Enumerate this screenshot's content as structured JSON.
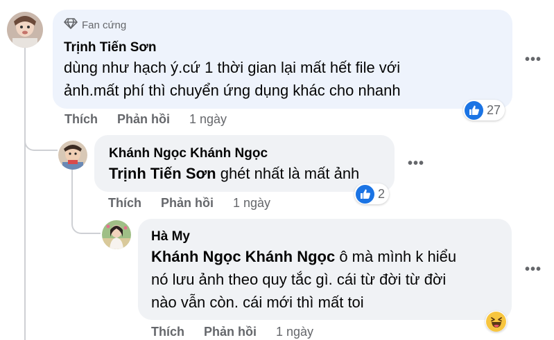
{
  "comments": [
    {
      "badge": "Fan cứng",
      "author": "Trịnh Tiến Sơn",
      "text_line1": "dùng như hạch ý.cứ 1 thời gian lại mất hết file với",
      "text_line2": "ảnh.mất phí thì chuyển ứng dụng khác cho nhanh",
      "reaction_count": "27",
      "like_label": "Thích",
      "reply_label": "Phản hồi",
      "time": "1 ngày"
    },
    {
      "author": "Khánh Ngọc Khánh Ngọc",
      "mention": "Trịnh Tiến Sơn",
      "text": " ghét nhất là mất ảnh",
      "reaction_count": "2",
      "like_label": "Thích",
      "reply_label": "Phản hồi",
      "time": "1 ngày"
    },
    {
      "author": "Hà My",
      "mention": "Khánh Ngọc Khánh Ngọc",
      "text_line1": " ô mà mình k hiểu",
      "text_line2": "nó lưu ảnh theo quy tắc gì. cái từ đời từ đời",
      "text_line3": "nào vẫn còn. cái mới thì mất toi",
      "like_label": "Thích",
      "reply_label": "Phản hồi",
      "time": "1 ngày"
    }
  ],
  "more_label": "•••",
  "colors": {
    "like_blue": "#1b74e4",
    "haha_yellow": "#f7c53f",
    "meta_gray": "#65676b"
  },
  "icons": {
    "badge": "diamond-icon",
    "like": "like-thumb-icon",
    "haha": "haha-face-icon"
  }
}
